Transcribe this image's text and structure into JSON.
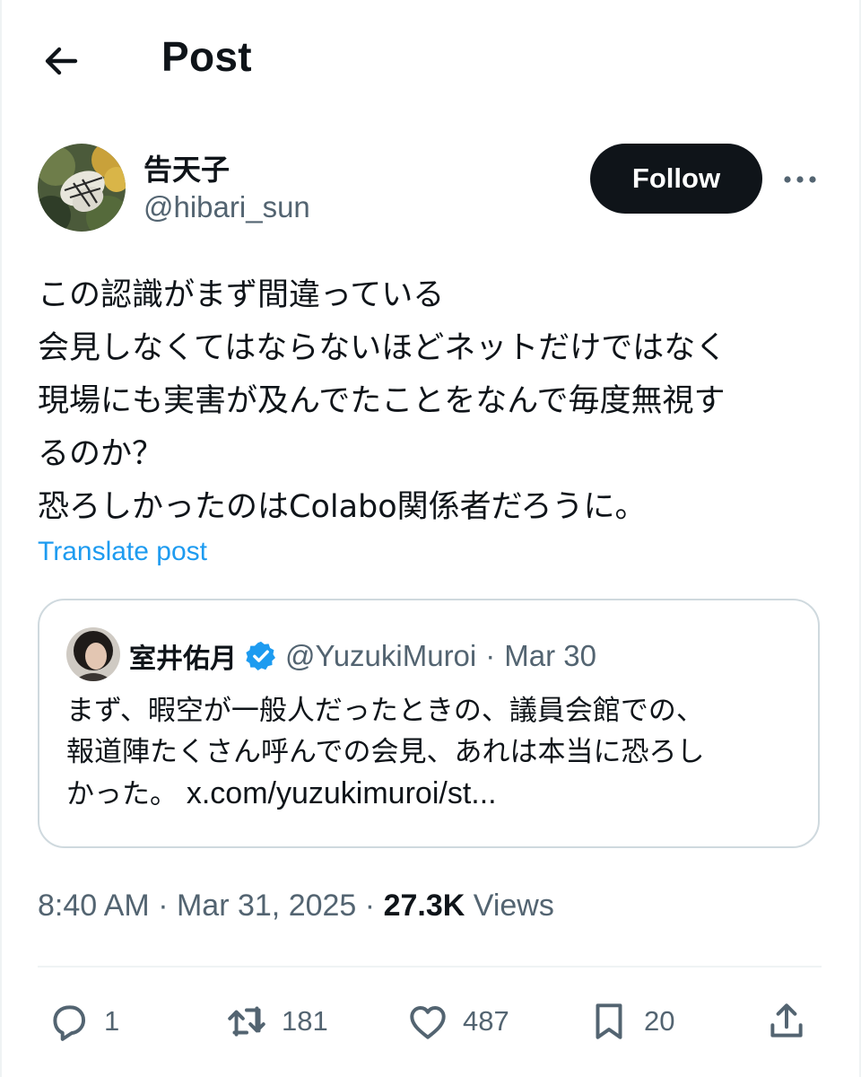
{
  "header": {
    "title": "Post"
  },
  "author": {
    "name": "告天子",
    "handle": "@hibari_sun"
  },
  "follow_label": "Follow",
  "post": {
    "lines": [
      "この認識がまず間違っている",
      "会見しなくてはならないほどネットだけではなく",
      "現場にも実害が及んでたことをなんで毎度無視す",
      "るのか？",
      "恐ろしかったのはColabo関係者だろうに。"
    ],
    "translate_label": "Translate post"
  },
  "quote": {
    "name": "室井佑月",
    "handle": "@YuzukiMuroi",
    "separator": "·",
    "date": "Mar 30",
    "lines": [
      "まず、暇空が一般人だったときの、議員会館での、",
      "報道陣たくさん呼んでの会見、あれは本当に恐ろし"
    ],
    "last_line_text": "かった。",
    "link": "x.com/yuzukimuroi/st..."
  },
  "meta": {
    "time": "8:40 AM",
    "sep1": "·",
    "date": "Mar 31, 2025",
    "sep2": "·",
    "views_count": "27.3K",
    "views_label": "Views"
  },
  "actions": {
    "replies": "1",
    "reposts": "181",
    "likes": "487",
    "bookmarks": "20"
  },
  "colors": {
    "accent": "#1d9bf0",
    "text": "#0f1419",
    "muted": "#536471",
    "border": "#cfd9de"
  }
}
